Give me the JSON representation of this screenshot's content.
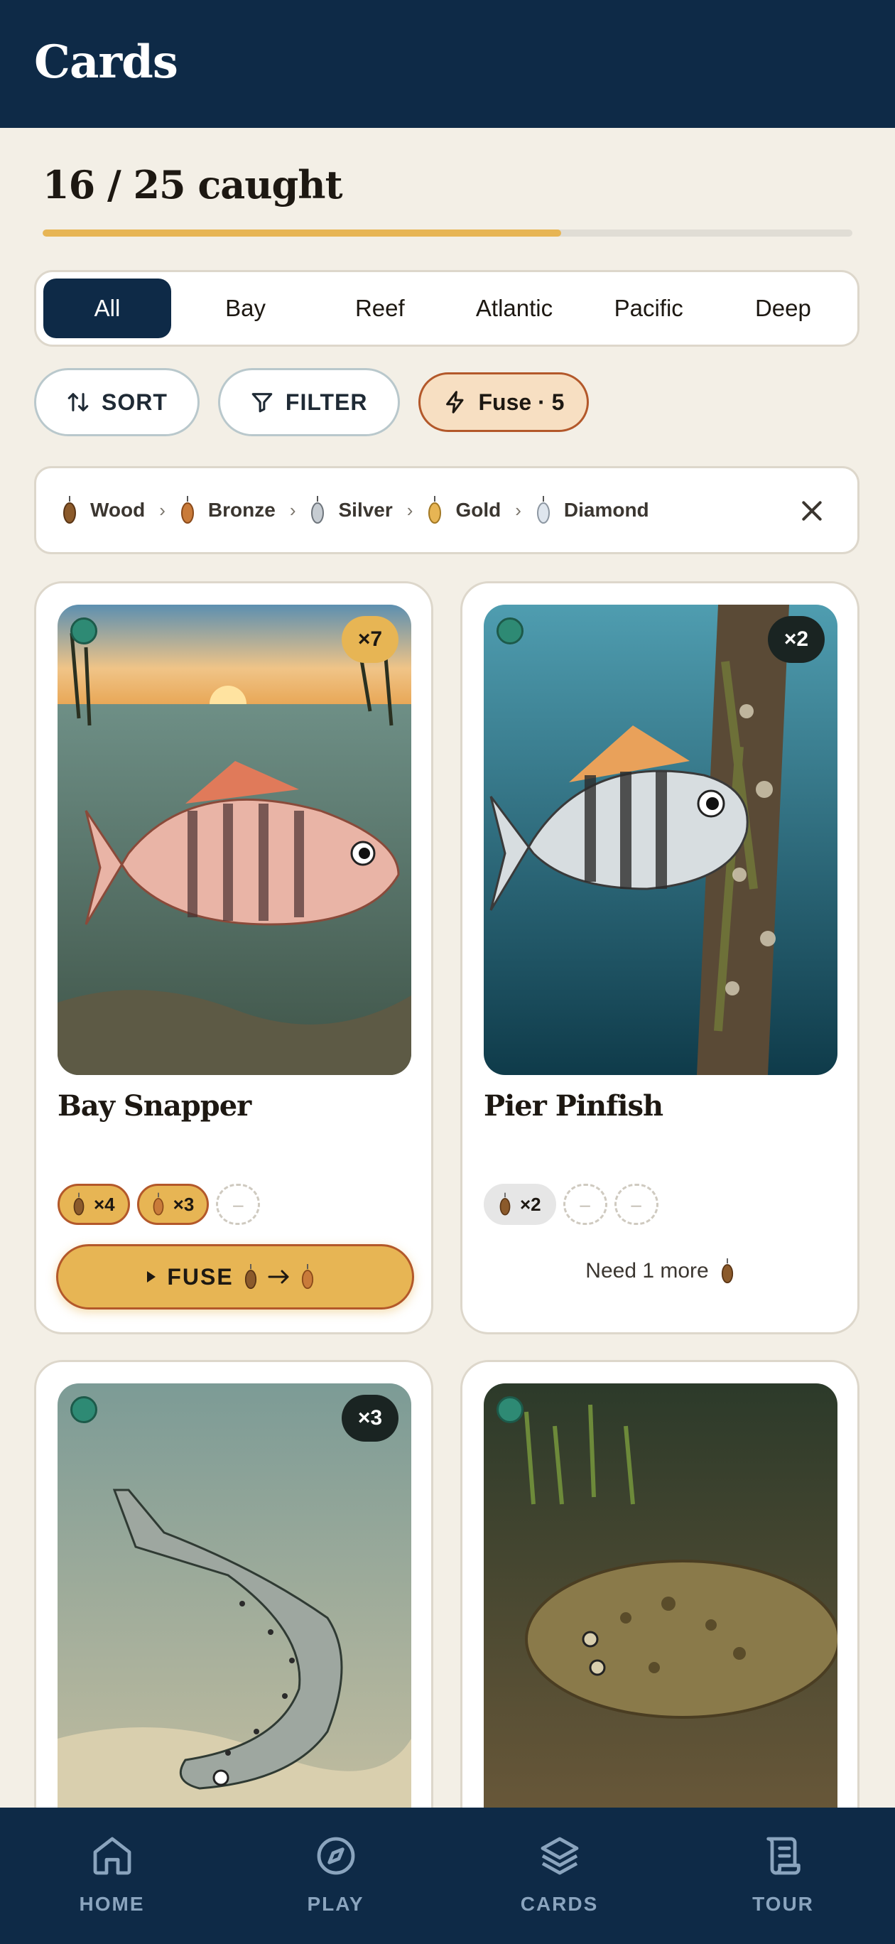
{
  "header": {
    "title": "Cards"
  },
  "progress": {
    "label": "16 / 25 caught",
    "caught": 16,
    "total": 25
  },
  "tabs": [
    "All",
    "Bay",
    "Reef",
    "Atlantic",
    "Pacific",
    "Deep"
  ],
  "active_tab": "All",
  "actions": {
    "sort": "SORT",
    "filter": "FILTER",
    "fuse": "Fuse · 5"
  },
  "tiers": [
    {
      "label": "Wood",
      "icon": "wood-lure-icon",
      "color": "#8b5a2b"
    },
    {
      "label": "Bronze",
      "icon": "bronze-lure-icon",
      "color": "#c97b3a"
    },
    {
      "label": "Silver",
      "icon": "silver-lure-icon",
      "color": "#c6ccd2"
    },
    {
      "label": "Gold",
      "icon": "gold-lure-icon",
      "color": "#e7b554"
    },
    {
      "label": "Diamond",
      "icon": "diamond-lure-icon",
      "color": "#dfe6ee"
    }
  ],
  "cards": [
    {
      "name": "Bay Snapper",
      "count": "×7",
      "chips": [
        "×4",
        "×3"
      ],
      "fuse_label": "FUSE",
      "need_more": ""
    },
    {
      "name": "Pier Pinfish",
      "count": "×2",
      "chips": [
        "×2"
      ],
      "fuse_label": "",
      "need_more": "Need 1 more"
    },
    {
      "name": "",
      "count": "×3",
      "chips": [],
      "fuse_label": "",
      "need_more": ""
    },
    {
      "name": "",
      "count": "",
      "chips": [],
      "fuse_label": "",
      "need_more": ""
    }
  ],
  "nav": [
    "HOME",
    "PLAY",
    "CARDS",
    "TOUR"
  ],
  "colors": {
    "navy": "#0e2a47",
    "gold": "#e7b554",
    "cream": "#f3efe6",
    "rust": "#b3582a"
  }
}
